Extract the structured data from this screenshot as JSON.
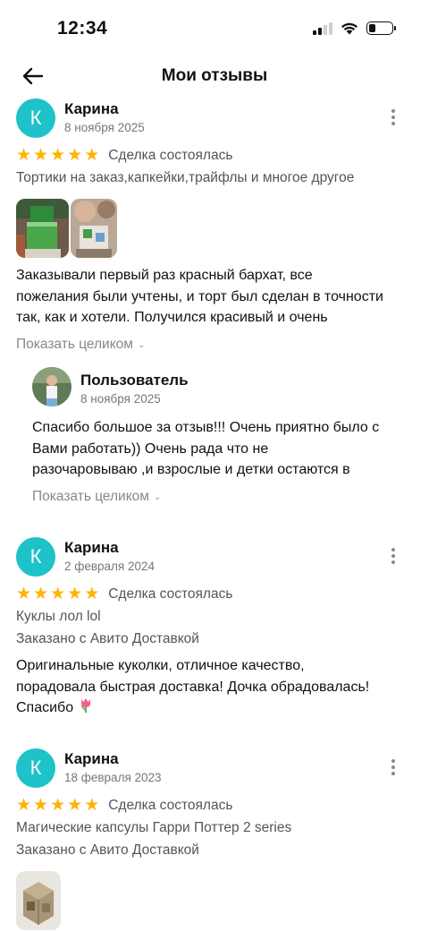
{
  "status_bar": {
    "time": "12:34"
  },
  "header": {
    "title": "Мои отзывы"
  },
  "reviews": [
    {
      "avatar_letter": "К",
      "author": "Карина",
      "date": "8 ноября 2025",
      "rating": 5,
      "deal_status": "Сделка состоялась",
      "item": "Тортики на заказ,капкейки,трайфлы и многое другое",
      "text_lines": [
        "Заказывали первый раз красный бархат, все",
        "пожелания были учтены, и торт был сделан в точности",
        "так, как и хотели. Получился красивый и очень"
      ],
      "show_more": "Показать целиком",
      "reply": {
        "author": "Пользователь",
        "date": "8 ноября 2025",
        "text_lines": [
          "Спасибо большое за отзыв!!! Очень приятно было с",
          "Вами работать)) Очень рада что не",
          "разочаровываю ,и взрослые и детки остаются в"
        ],
        "show_more": "Показать целиком"
      }
    },
    {
      "avatar_letter": "К",
      "author": "Карина",
      "date": "2 февраля 2024",
      "rating": 5,
      "deal_status": "Сделка состоялась",
      "item": "Куклы лол lol",
      "delivery": "Заказано с Авито Доставкой",
      "text_lines": [
        "Оригинальные куколки, отличное качество,",
        "порадовала быстрая доставка! Дочка обрадовалась!",
        "Спасибо"
      ]
    },
    {
      "avatar_letter": "К",
      "author": "Карина",
      "date": "18 февраля 2023",
      "rating": 5,
      "deal_status": "Сделка состоялась",
      "item": "Магические капсулы Гарри Поттер 2 series",
      "delivery": "Заказано с Авито Доставкой"
    }
  ],
  "colors": {
    "avatar": "#1ec2c9",
    "star": "#ffb300",
    "secondary_text": "#777777"
  },
  "icons": {
    "back": "arrow-left-icon",
    "more": "more-vertical-icon",
    "star": "star-icon",
    "tulip": "tulip-emoji-icon"
  }
}
